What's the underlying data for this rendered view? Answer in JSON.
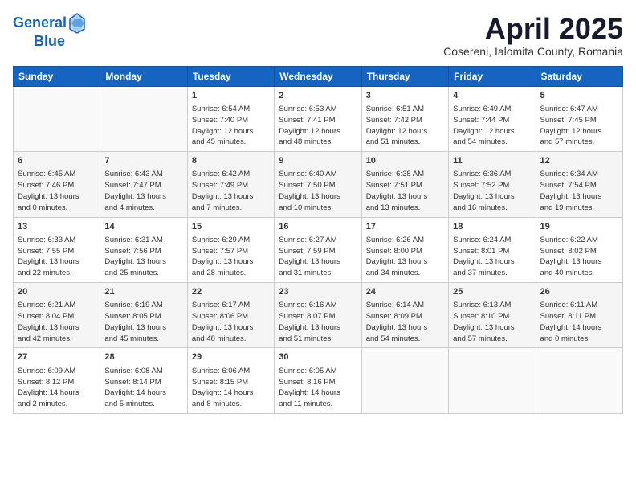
{
  "header": {
    "logo_line1": "General",
    "logo_line2": "Blue",
    "title": "April 2025",
    "subtitle": "Cosereni, Ialomita County, Romania"
  },
  "weekdays": [
    "Sunday",
    "Monday",
    "Tuesday",
    "Wednesday",
    "Thursday",
    "Friday",
    "Saturday"
  ],
  "weeks": [
    [
      {
        "day": "",
        "info": ""
      },
      {
        "day": "",
        "info": ""
      },
      {
        "day": "1",
        "info": "Sunrise: 6:54 AM\nSunset: 7:40 PM\nDaylight: 12 hours\nand 45 minutes."
      },
      {
        "day": "2",
        "info": "Sunrise: 6:53 AM\nSunset: 7:41 PM\nDaylight: 12 hours\nand 48 minutes."
      },
      {
        "day": "3",
        "info": "Sunrise: 6:51 AM\nSunset: 7:42 PM\nDaylight: 12 hours\nand 51 minutes."
      },
      {
        "day": "4",
        "info": "Sunrise: 6:49 AM\nSunset: 7:44 PM\nDaylight: 12 hours\nand 54 minutes."
      },
      {
        "day": "5",
        "info": "Sunrise: 6:47 AM\nSunset: 7:45 PM\nDaylight: 12 hours\nand 57 minutes."
      }
    ],
    [
      {
        "day": "6",
        "info": "Sunrise: 6:45 AM\nSunset: 7:46 PM\nDaylight: 13 hours\nand 0 minutes."
      },
      {
        "day": "7",
        "info": "Sunrise: 6:43 AM\nSunset: 7:47 PM\nDaylight: 13 hours\nand 4 minutes."
      },
      {
        "day": "8",
        "info": "Sunrise: 6:42 AM\nSunset: 7:49 PM\nDaylight: 13 hours\nand 7 minutes."
      },
      {
        "day": "9",
        "info": "Sunrise: 6:40 AM\nSunset: 7:50 PM\nDaylight: 13 hours\nand 10 minutes."
      },
      {
        "day": "10",
        "info": "Sunrise: 6:38 AM\nSunset: 7:51 PM\nDaylight: 13 hours\nand 13 minutes."
      },
      {
        "day": "11",
        "info": "Sunrise: 6:36 AM\nSunset: 7:52 PM\nDaylight: 13 hours\nand 16 minutes."
      },
      {
        "day": "12",
        "info": "Sunrise: 6:34 AM\nSunset: 7:54 PM\nDaylight: 13 hours\nand 19 minutes."
      }
    ],
    [
      {
        "day": "13",
        "info": "Sunrise: 6:33 AM\nSunset: 7:55 PM\nDaylight: 13 hours\nand 22 minutes."
      },
      {
        "day": "14",
        "info": "Sunrise: 6:31 AM\nSunset: 7:56 PM\nDaylight: 13 hours\nand 25 minutes."
      },
      {
        "day": "15",
        "info": "Sunrise: 6:29 AM\nSunset: 7:57 PM\nDaylight: 13 hours\nand 28 minutes."
      },
      {
        "day": "16",
        "info": "Sunrise: 6:27 AM\nSunset: 7:59 PM\nDaylight: 13 hours\nand 31 minutes."
      },
      {
        "day": "17",
        "info": "Sunrise: 6:26 AM\nSunset: 8:00 PM\nDaylight: 13 hours\nand 34 minutes."
      },
      {
        "day": "18",
        "info": "Sunrise: 6:24 AM\nSunset: 8:01 PM\nDaylight: 13 hours\nand 37 minutes."
      },
      {
        "day": "19",
        "info": "Sunrise: 6:22 AM\nSunset: 8:02 PM\nDaylight: 13 hours\nand 40 minutes."
      }
    ],
    [
      {
        "day": "20",
        "info": "Sunrise: 6:21 AM\nSunset: 8:04 PM\nDaylight: 13 hours\nand 42 minutes."
      },
      {
        "day": "21",
        "info": "Sunrise: 6:19 AM\nSunset: 8:05 PM\nDaylight: 13 hours\nand 45 minutes."
      },
      {
        "day": "22",
        "info": "Sunrise: 6:17 AM\nSunset: 8:06 PM\nDaylight: 13 hours\nand 48 minutes."
      },
      {
        "day": "23",
        "info": "Sunrise: 6:16 AM\nSunset: 8:07 PM\nDaylight: 13 hours\nand 51 minutes."
      },
      {
        "day": "24",
        "info": "Sunrise: 6:14 AM\nSunset: 8:09 PM\nDaylight: 13 hours\nand 54 minutes."
      },
      {
        "day": "25",
        "info": "Sunrise: 6:13 AM\nSunset: 8:10 PM\nDaylight: 13 hours\nand 57 minutes."
      },
      {
        "day": "26",
        "info": "Sunrise: 6:11 AM\nSunset: 8:11 PM\nDaylight: 14 hours\nand 0 minutes."
      }
    ],
    [
      {
        "day": "27",
        "info": "Sunrise: 6:09 AM\nSunset: 8:12 PM\nDaylight: 14 hours\nand 2 minutes."
      },
      {
        "day": "28",
        "info": "Sunrise: 6:08 AM\nSunset: 8:14 PM\nDaylight: 14 hours\nand 5 minutes."
      },
      {
        "day": "29",
        "info": "Sunrise: 6:06 AM\nSunset: 8:15 PM\nDaylight: 14 hours\nand 8 minutes."
      },
      {
        "day": "30",
        "info": "Sunrise: 6:05 AM\nSunset: 8:16 PM\nDaylight: 14 hours\nand 11 minutes."
      },
      {
        "day": "",
        "info": ""
      },
      {
        "day": "",
        "info": ""
      },
      {
        "day": "",
        "info": ""
      }
    ]
  ]
}
